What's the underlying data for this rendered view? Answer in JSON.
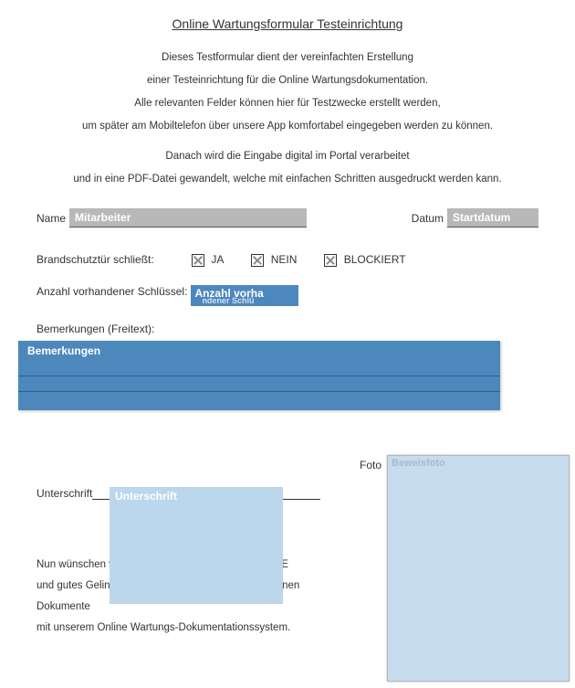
{
  "title": "Online Wartungsformular Testeinrichtung",
  "intro": {
    "l1": "Dieses Testformular dient der vereinfachten Erstellung",
    "l2": "einer Testeinrichtung für die Online Wartungsdokumentation.",
    "l3": "Alle relevanten Felder können hier für Testzwecke erstellt werden,",
    "l4": "um später am Mobiltelefon über unsere App komfortabel eingegeben werden zu können.",
    "l5": "Danach wird die Eingabe digital im Portal verarbeitet",
    "l6": "und in eine PDF-Datei gewandelt, welche mit einfachen Schritten ausgedruckt werden kann."
  },
  "name": {
    "label": "Name",
    "placeholder": "Mitarbeiter"
  },
  "date": {
    "label": "Datum",
    "placeholder": "Startdatum"
  },
  "door": {
    "label": "Brandschutztür schließt:",
    "opt_yes": "JA",
    "opt_no": "NEIN",
    "opt_blocked": "BLOCKIERT"
  },
  "keys": {
    "label": "Anzahl vorhandener Schlüssel:",
    "placeholder_top": "Anzahl vorha",
    "placeholder_sub": "ndener Schlü"
  },
  "remarks": {
    "label": "Bemerkungen (Freitext):",
    "placeholder": "Bemerkungen"
  },
  "signature": {
    "label": "Unterschrift",
    "placeholder": "Unterschrift"
  },
  "photo": {
    "label": "Foto",
    "placeholder": "Beweisfoto"
  },
  "closing": {
    "l1": "Nun wünschen wir Ihnen viel Erfolg mit COREDINATE",
    "l2": "und gutes Gelingen beim Einpflegen Ihrer firmeneigenen Dokumente",
    "l3": "mit unserem Online Wartungs-Dokumentationssystem."
  }
}
